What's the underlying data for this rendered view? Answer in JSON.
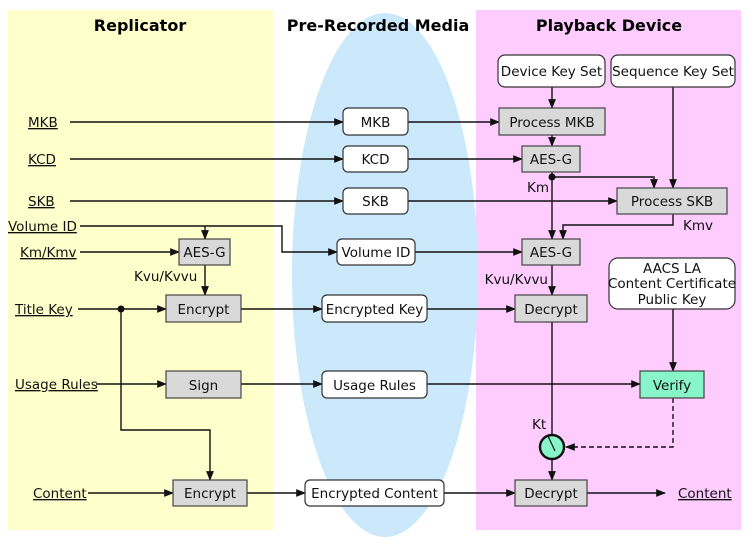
{
  "colors": {
    "replicator_bg": "#FFFFCC",
    "media_bg": "#CCE8FB",
    "playback_bg": "#FFCCFF",
    "process_box": "#D9D9D9",
    "verify_box": "#88F5C8"
  },
  "headers": {
    "replicator": "Replicator",
    "media": "Pre-Recorded Media",
    "playback": "Playback Device"
  },
  "inputs": {
    "mkb": "MKB",
    "kcd": "KCD",
    "skb": "SKB",
    "volume_id": "Volume ID",
    "km_kmv": "Km/Kmv",
    "title_key": "Title Key",
    "usage_rules": "Usage Rules",
    "content": "Content"
  },
  "replicator": {
    "aes_g": "AES-G",
    "kvu_kvvu": "Kvu/Kvvu",
    "encrypt_key": "Encrypt",
    "sign": "Sign",
    "encrypt_content": "Encrypt"
  },
  "media": {
    "mkb": "MKB",
    "kcd": "KCD",
    "skb": "SKB",
    "volume_id": "Volume ID",
    "encrypted_key": "Encrypted Key",
    "usage_rules": "Usage Rules",
    "encrypted_content": "Encrypted Content"
  },
  "playback": {
    "device_key_set": "Device Key Set",
    "sequence_key_set": "Sequence Key Set",
    "process_mkb": "Process MKB",
    "aes_g_1": "AES-G",
    "km": "Km",
    "process_skb": "Process SKB",
    "kmv": "Kmv",
    "aes_g_2": "AES-G",
    "kvu_kvvu": "Kvu/Kvvu",
    "decrypt_key": "Decrypt",
    "cert_line1": "AACS LA",
    "cert_line2": "Content Certificate",
    "cert_line3": "Public Key",
    "verify": "Verify",
    "kt": "Kt",
    "decrypt_content": "Decrypt",
    "content_out": "Content"
  }
}
